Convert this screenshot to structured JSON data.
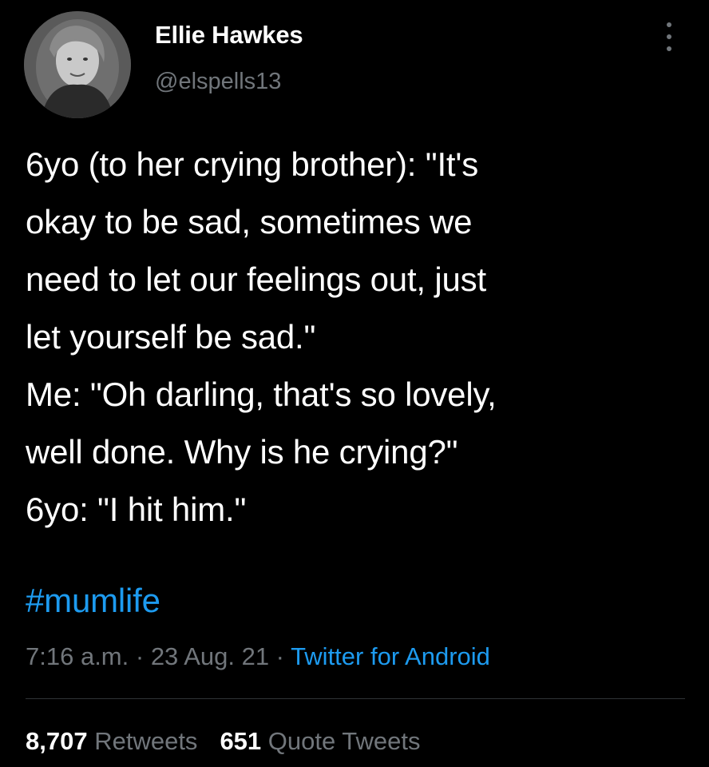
{
  "author": {
    "display_name": "Ellie Hawkes",
    "handle": "@elspells13"
  },
  "menu": {
    "icon": "more-icon"
  },
  "tweet": {
    "text": "6yo (to her crying brother): \"It's\nokay to be sad, sometimes we\nneed to let our feelings out, just\nlet yourself be sad.\"\nMe: \"Oh darling, that's so lovely,\nwell done. Why is he crying?\"\n6yo: \"I hit him.\"",
    "hashtag": "#mumlife"
  },
  "meta": {
    "time": "7:16 a.m.",
    "sep1": " · ",
    "date": "23 Aug. 21",
    "sep2": " · ",
    "source": "Twitter for Android"
  },
  "stats": {
    "retweets_count": "8,707",
    "retweets_label": "Retweets",
    "quotes_count": "651",
    "quotes_label": "Quote Tweets"
  },
  "colors": {
    "background": "#000000",
    "text": "#ffffff",
    "secondary": "#71767b",
    "accent": "#1d9bf0",
    "divider": "#2f3336"
  }
}
